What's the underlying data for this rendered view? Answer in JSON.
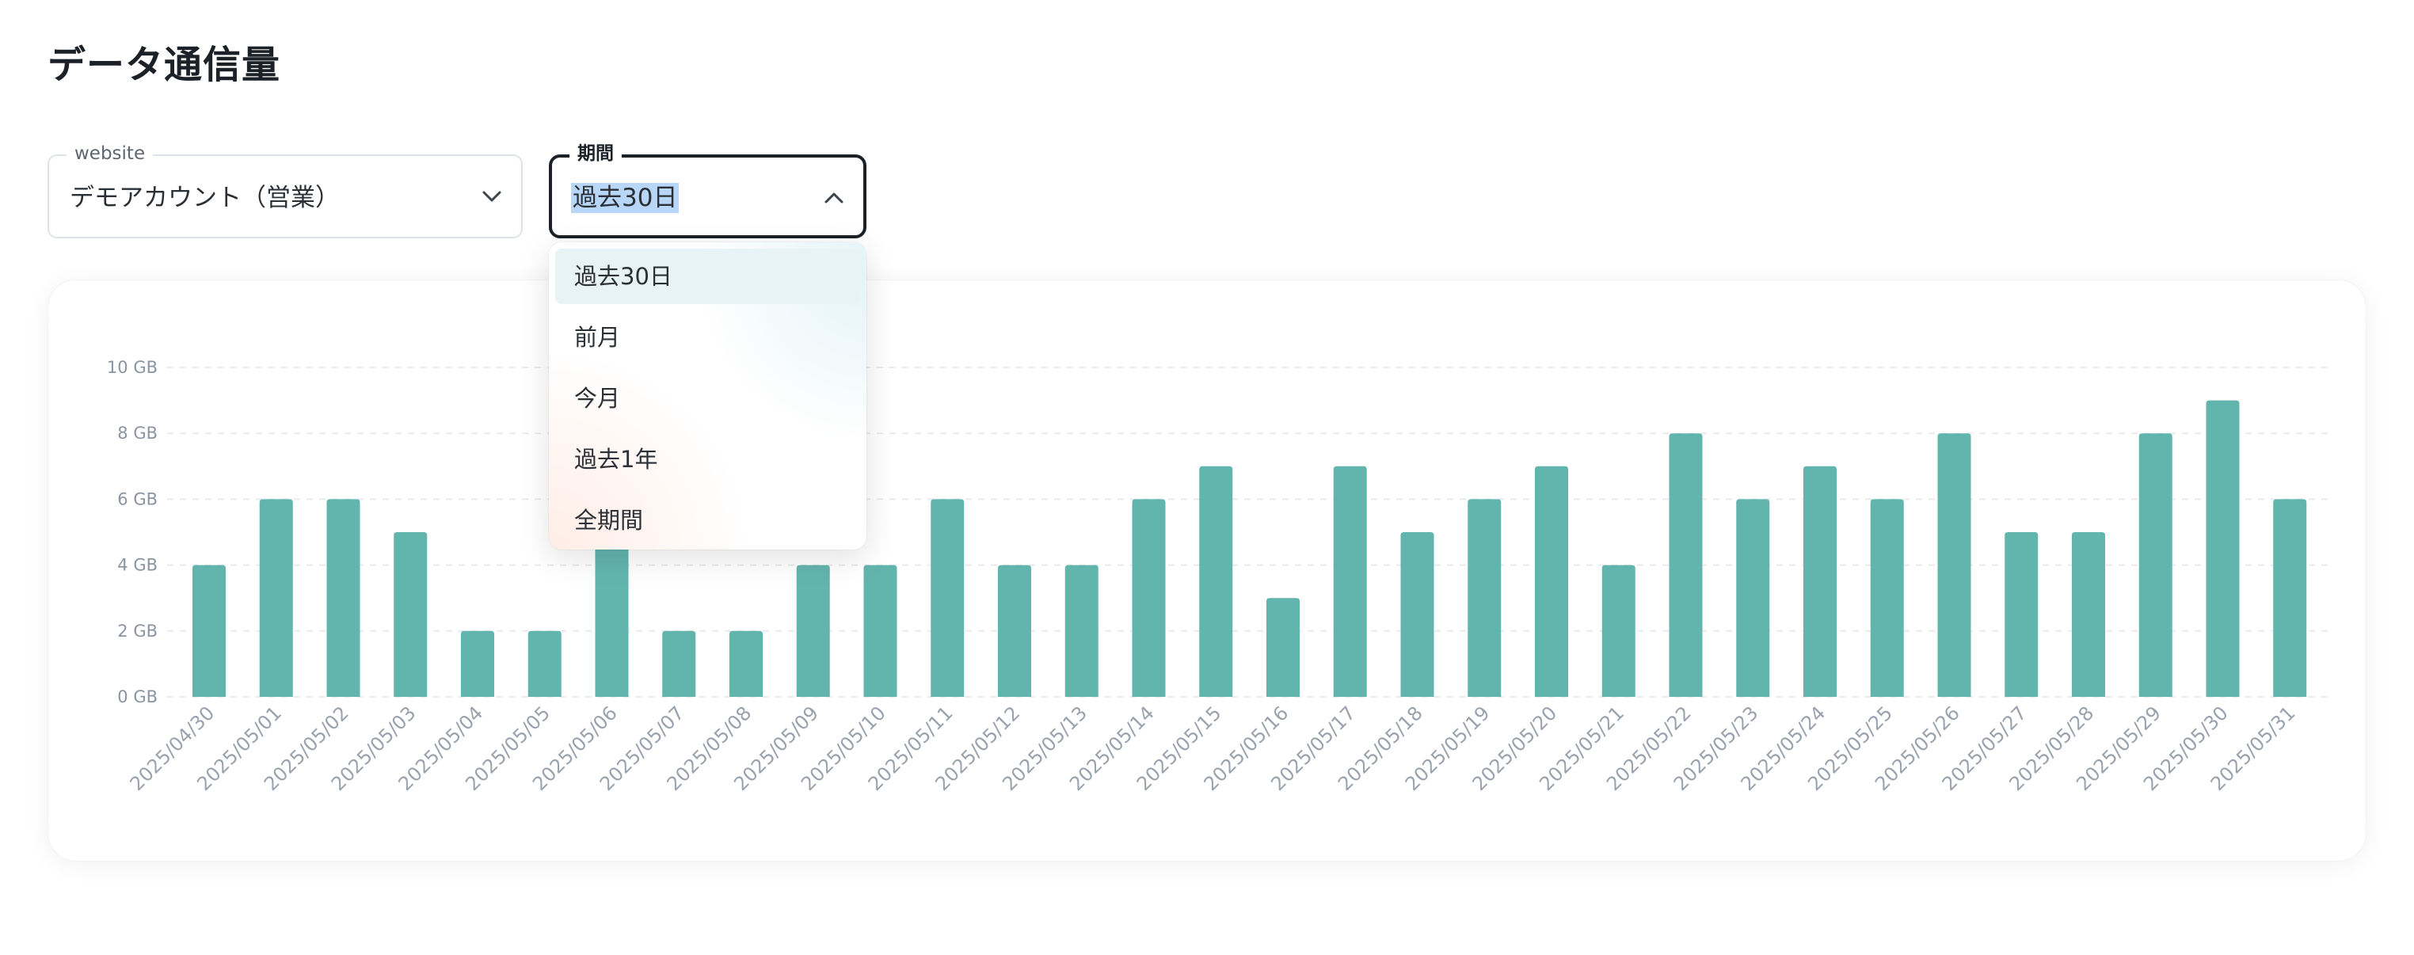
{
  "page": {
    "title": "データ通信量"
  },
  "filters": {
    "website": {
      "label": "website",
      "value": "デモアカウント（営業）"
    },
    "period": {
      "label": "期間",
      "value": "過去30日",
      "options": [
        "過去30日",
        "前月",
        "今月",
        "過去1年",
        "全期間"
      ],
      "selected_index": 0
    }
  },
  "colors": {
    "bar": "#62b5ad",
    "grid": "#e8ebee",
    "accent_border": "#1c2127"
  },
  "chart_data": {
    "type": "bar",
    "title": "",
    "xlabel": "",
    "ylabel": "",
    "categories": [
      "2025/04/30",
      "2025/05/01",
      "2025/05/02",
      "2025/05/03",
      "2025/05/04",
      "2025/05/05",
      "2025/05/06",
      "2025/05/07",
      "2025/05/08",
      "2025/05/09",
      "2025/05/10",
      "2025/05/11",
      "2025/05/12",
      "2025/05/13",
      "2025/05/14",
      "2025/05/15",
      "2025/05/16",
      "2025/05/17",
      "2025/05/18",
      "2025/05/19",
      "2025/05/20",
      "2025/05/21",
      "2025/05/22",
      "2025/05/23",
      "2025/05/24",
      "2025/05/25",
      "2025/05/26",
      "2025/05/27",
      "2025/05/28",
      "2025/05/29",
      "2025/05/30",
      "2025/05/31"
    ],
    "values": [
      4,
      6,
      6,
      5,
      2,
      2,
      6,
      2,
      2,
      4,
      4,
      6,
      4,
      4,
      6,
      7,
      3,
      7,
      5,
      6,
      7,
      4,
      8,
      6,
      7,
      6,
      8,
      5,
      5,
      8,
      9,
      6
    ],
    "unit": "GB",
    "ylim": [
      0,
      10
    ],
    "yticks": [
      "0 GB",
      "2 GB",
      "4 GB",
      "6 GB",
      "8 GB",
      "10 GB"
    ],
    "grid": true
  }
}
